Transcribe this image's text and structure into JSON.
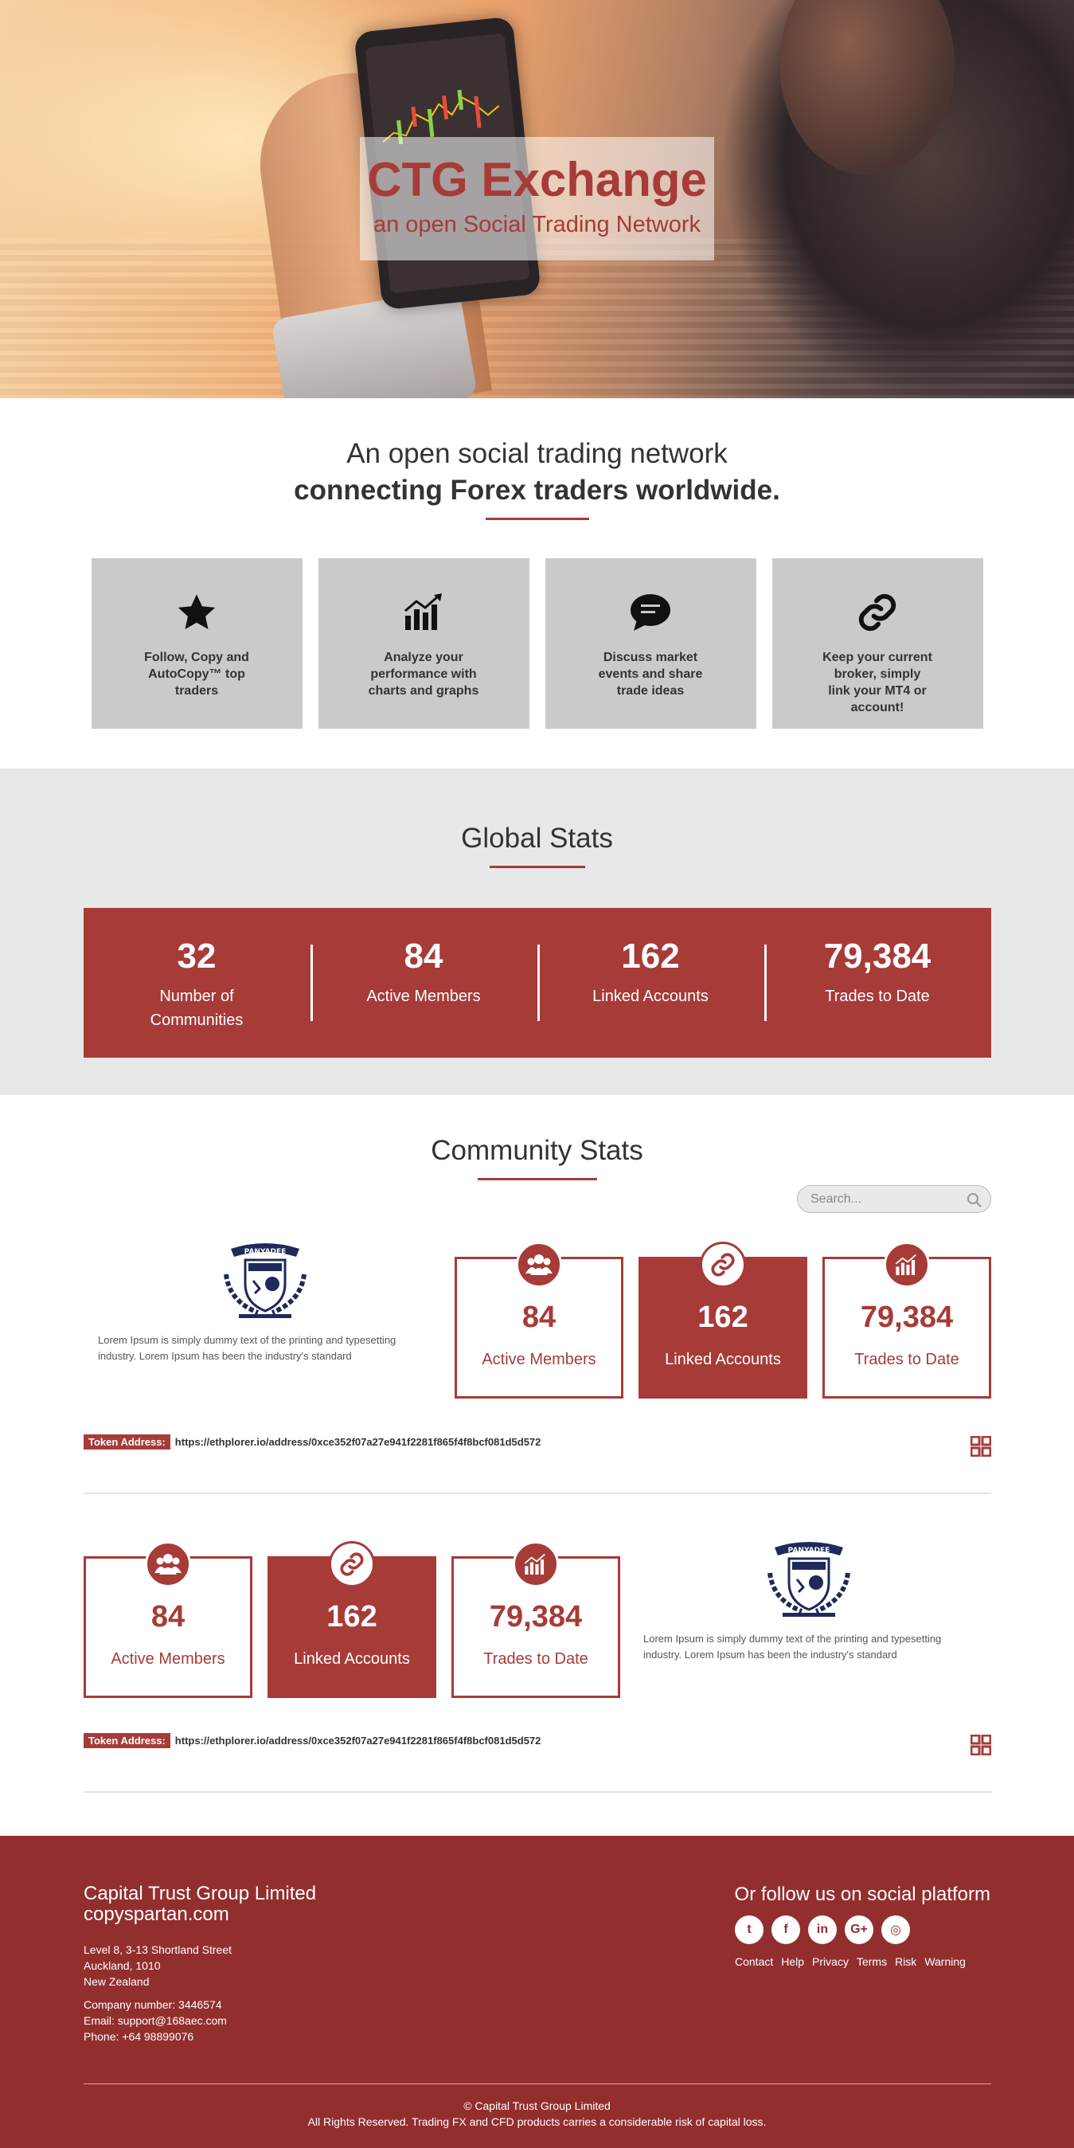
{
  "hero": {
    "title": "CTG Exchange",
    "subtitle": "an open Social Trading Network"
  },
  "intro": {
    "line1": "An open social trading network",
    "line2": "connecting Forex traders worldwide."
  },
  "features": [
    {
      "icon": "star-icon",
      "text": "Follow, Copy and AutoCopy™ top traders"
    },
    {
      "icon": "chart-growth-icon",
      "text": "Analyze your performance with charts and graphs"
    },
    {
      "icon": "chat-bubble-icon",
      "text": "Discuss market events and share trade ideas"
    },
    {
      "icon": "link-icon",
      "text": "Keep your current broker, simply link your MT4 or account!"
    }
  ],
  "global": {
    "title": "Global Stats",
    "stats": [
      {
        "value": "32",
        "label": "Number of Communities"
      },
      {
        "value": "84",
        "label": "Active Members"
      },
      {
        "value": "162",
        "label": "Linked Accounts"
      },
      {
        "value": "79,384",
        "label": "Trades to Date"
      }
    ]
  },
  "community": {
    "title": "Community Stats",
    "search_placeholder": "Search...",
    "blocks": [
      {
        "lorem": "Lorem Ipsum is simply dummy text of the printing and typesetting industry. Lorem Ipsum has been the industry's standard",
        "cards": [
          {
            "icon": "users-icon",
            "value": "84",
            "label": "Active Members"
          },
          {
            "icon": "link-icon",
            "value": "162",
            "label": "Linked Accounts"
          },
          {
            "icon": "chart-growth-icon",
            "value": "79,384",
            "label": "Trades to Date"
          }
        ],
        "token_label": "Token Address:",
        "token_value": "https://ethplorer.io/address/0xce352f07a27e941f2281f865f4f8bcf081d5d572"
      },
      {
        "lorem": "Lorem Ipsum is simply dummy text of the printing and typesetting industry. Lorem Ipsum has been the industry's standard",
        "cards": [
          {
            "icon": "users-icon",
            "value": "84",
            "label": "Active Members"
          },
          {
            "icon": "link-icon",
            "value": "162",
            "label": "Linked Accounts"
          },
          {
            "icon": "chart-growth-icon",
            "value": "79,384",
            "label": "Trades to Date"
          }
        ],
        "token_label": "Token Address:",
        "token_value": "https://ethplorer.io/address/0xce352f07a27e941f2281f865f4f8bcf081d5d572"
      }
    ]
  },
  "footer": {
    "company": "Capital Trust Group Limited",
    "site": "copyspartan.com",
    "address": [
      "Level 8, 3-13 Shortland Street",
      "Auckland, 1010",
      "New Zealand"
    ],
    "company_number": "Company number: 3446574",
    "email": "Email: support@168aec.com",
    "phone": "Phone: +64 98899076",
    "follow_title": "Or follow us on social platform",
    "social": [
      {
        "icon": "twitter-icon",
        "glyph": "t"
      },
      {
        "icon": "facebook-icon",
        "glyph": "f"
      },
      {
        "icon": "linkedin-icon",
        "glyph": "in"
      },
      {
        "icon": "google-plus-icon",
        "glyph": "G+"
      },
      {
        "icon": "instagram-icon",
        "glyph": "◎"
      }
    ],
    "links": [
      "Contact",
      "Help",
      "Privacy",
      "Terms",
      "Risk",
      "Warning"
    ],
    "copyright": "© Capital Trust Group Limited",
    "disclaimer": "All Rights Reserved. Trading FX and CFD products carries a considerable risk of capital loss."
  },
  "colors": {
    "accent": "#a63b38",
    "footer": "#922f2e",
    "feature_bg": "#cacaca",
    "stats_bg": "#e8e8e8"
  }
}
